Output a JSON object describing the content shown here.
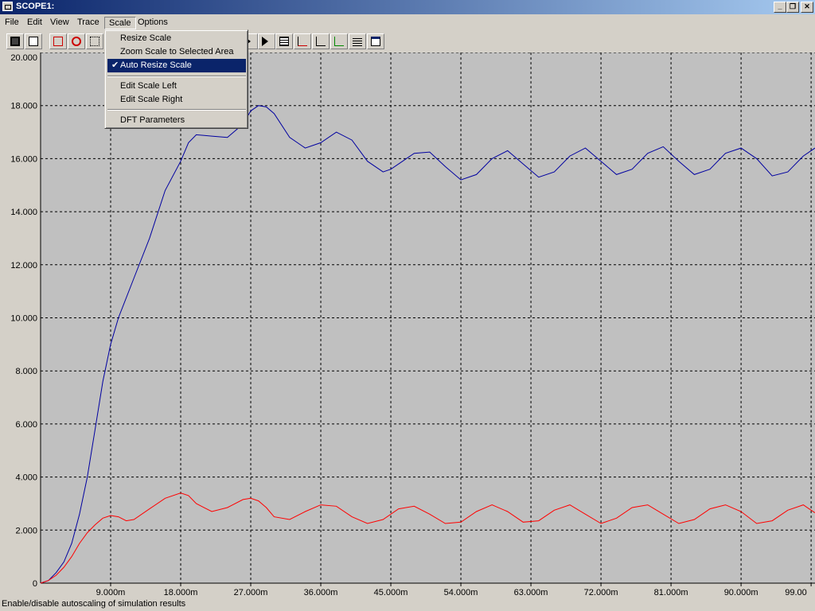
{
  "window": {
    "title": "SCOPE1:"
  },
  "menubar": {
    "items": [
      "File",
      "Edit",
      "View",
      "Trace",
      "Scale",
      "Options"
    ],
    "active": "Scale"
  },
  "toolbar": {
    "buttons": [
      "save-icon",
      "print-icon",
      "cursor-icon",
      "target-icon",
      "select-area-icon",
      "play-icon",
      "skip-end-icon",
      "table-icon",
      "chart-icon",
      "circle-chart-icon",
      "axis-icon",
      "list-icon",
      "window-icon"
    ]
  },
  "scale_menu": {
    "items": [
      "Resize Scale",
      "Zoom Scale to Selected Area",
      "Auto Resize Scale",
      "Edit Scale Left",
      "Edit Scale Right",
      "DFT Parameters"
    ],
    "checked": "Auto Resize Scale",
    "highlighted": "Auto Resize Scale"
  },
  "status": {
    "text": "Enable/disable autoscaling of simulation results"
  },
  "chart_data": {
    "type": "line",
    "xlim": [
      0,
      99.5
    ],
    "ylim": [
      0,
      20
    ],
    "x_ticks": [
      9,
      18,
      27,
      36,
      45,
      54,
      63,
      72,
      81,
      90,
      99
    ],
    "x_tick_labels": [
      "9.000m",
      "18.000m",
      "27.000m",
      "36.000m",
      "45.000m",
      "54.000m",
      "63.000m",
      "72.000m",
      "81.000m",
      "90.000m",
      "99.00"
    ],
    "y_ticks": [
      0,
      2,
      4,
      6,
      8,
      10,
      12,
      14,
      16,
      18,
      20
    ],
    "y_tick_labels": [
      "0",
      "2.000",
      "4.000",
      "6.000",
      "8.000",
      "10.000",
      "12.000",
      "14.000",
      "16.000",
      "18.000",
      "20.000"
    ],
    "grid": true,
    "background": "#c0c0c0",
    "series": [
      {
        "color": "#0000a0",
        "x": [
          0,
          1,
          2,
          3,
          4,
          5,
          6,
          7,
          8,
          9,
          10,
          12,
          14,
          16,
          18,
          19,
          20,
          22,
          24,
          26,
          27,
          28,
          29,
          30,
          32,
          34,
          36,
          38,
          40,
          42,
          44,
          45,
          48,
          50,
          52,
          54,
          56,
          58,
          60,
          62,
          64,
          66,
          68,
          70,
          72,
          74,
          76,
          78,
          80,
          82,
          84,
          86,
          88,
          90,
          92,
          94,
          96,
          98,
          99.5
        ],
        "y": [
          0,
          0.1,
          0.4,
          0.8,
          1.5,
          2.6,
          4.0,
          5.8,
          7.6,
          9.0,
          10.0,
          11.5,
          13.0,
          14.8,
          15.9,
          16.6,
          16.9,
          16.85,
          16.8,
          17.3,
          17.8,
          18.0,
          17.95,
          17.7,
          16.8,
          16.4,
          16.6,
          17.0,
          16.7,
          15.9,
          15.5,
          15.6,
          16.2,
          16.25,
          15.7,
          15.2,
          15.4,
          16.0,
          16.3,
          15.8,
          15.3,
          15.5,
          16.1,
          16.4,
          15.9,
          15.4,
          15.6,
          16.2,
          16.45,
          15.9,
          15.4,
          15.6,
          16.2,
          16.4,
          16.0,
          15.35,
          15.5,
          16.1,
          16.4
        ]
      },
      {
        "color": "#ff0000",
        "x": [
          0,
          1,
          2,
          3,
          4,
          5,
          6,
          7,
          8,
          9,
          10,
          11,
          12,
          14,
          16,
          18,
          19,
          20,
          22,
          24,
          26,
          27,
          28,
          29,
          30,
          32,
          34,
          36,
          38,
          40,
          42,
          44,
          46,
          48,
          50,
          52,
          54,
          56,
          58,
          60,
          62,
          64,
          66,
          68,
          70,
          72,
          74,
          76,
          78,
          80,
          82,
          84,
          86,
          88,
          90,
          92,
          94,
          96,
          98,
          99.5
        ],
        "y": [
          0,
          0.1,
          0.3,
          0.6,
          1.0,
          1.5,
          1.9,
          2.2,
          2.45,
          2.55,
          2.5,
          2.35,
          2.4,
          2.8,
          3.2,
          3.4,
          3.3,
          3.0,
          2.7,
          2.85,
          3.15,
          3.2,
          3.1,
          2.85,
          2.5,
          2.4,
          2.7,
          2.95,
          2.9,
          2.5,
          2.25,
          2.4,
          2.8,
          2.9,
          2.6,
          2.25,
          2.3,
          2.7,
          2.95,
          2.7,
          2.3,
          2.35,
          2.75,
          2.95,
          2.6,
          2.25,
          2.45,
          2.85,
          2.95,
          2.6,
          2.25,
          2.4,
          2.8,
          2.95,
          2.7,
          2.25,
          2.35,
          2.75,
          2.95,
          2.65
        ]
      }
    ]
  }
}
